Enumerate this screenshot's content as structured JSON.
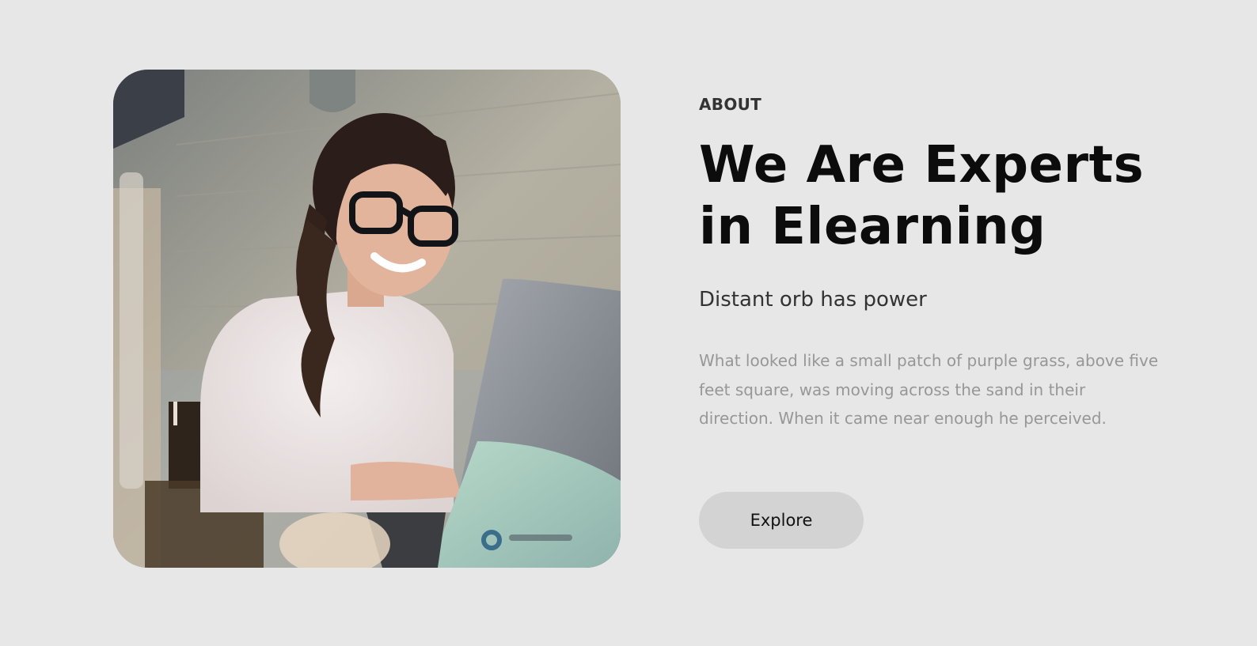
{
  "about": {
    "eyebrow": "ABOUT",
    "headline_line1": "We Are Experts",
    "headline_line2": "in Elearning",
    "subheadline": "Distant orb has power",
    "body": "What looked like a small patch of purple grass, above five feet square, was moving across the sand in their direction. When it came near enough he perceived.",
    "button_label": "Explore"
  },
  "colors": {
    "background": "#e7e7e7",
    "button_bg": "#d3d3d3",
    "heading": "#0c0c0c",
    "body_text": "#979797"
  }
}
